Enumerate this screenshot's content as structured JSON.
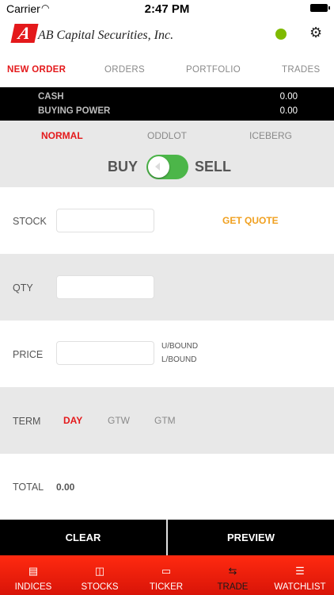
{
  "status_bar": {
    "carrier": "Carrier",
    "time": "2:47 PM"
  },
  "header": {
    "logo_letter": "A",
    "company": "AB Capital Securities, Inc.",
    "connection_color": "#7fba00"
  },
  "nav": [
    {
      "label": "NEW ORDER",
      "active": true
    },
    {
      "label": "ORDERS",
      "active": false
    },
    {
      "label": "PORTFOLIO",
      "active": false
    },
    {
      "label": "TRADES",
      "active": false
    }
  ],
  "balances": {
    "cash_label": "CASH",
    "cash_value": "0.00",
    "buying_power_label": "BUYING POWER",
    "buying_power_value": "0.00"
  },
  "order_types": [
    {
      "label": "NORMAL",
      "active": true
    },
    {
      "label": "ODDLOT",
      "active": false
    },
    {
      "label": "ICEBERG",
      "active": false
    }
  ],
  "side": {
    "buy_label": "BUY",
    "sell_label": "SELL",
    "toggle_color": "#4cb649"
  },
  "form": {
    "stock_label": "STOCK",
    "stock_value": "",
    "get_quote": "GET QUOTE",
    "qty_label": "QTY",
    "qty_value": "",
    "price_label": "PRICE",
    "price_value": "",
    "upper_bound": "U/BOUND",
    "lower_bound": "L/BOUND",
    "term_label": "TERM",
    "terms": [
      {
        "label": "DAY",
        "active": true
      },
      {
        "label": "GTW",
        "active": false
      },
      {
        "label": "GTM",
        "active": false
      }
    ],
    "total_label": "TOTAL",
    "total_value": "0.00"
  },
  "actions": {
    "clear": "CLEAR",
    "preview": "PREVIEW"
  },
  "tabbar": [
    {
      "label": "INDICES",
      "icon": "indices-icon",
      "active": false
    },
    {
      "label": "STOCKS",
      "icon": "stocks-icon",
      "active": false
    },
    {
      "label": "TICKER",
      "icon": "ticker-icon",
      "active": false
    },
    {
      "label": "TRADE",
      "icon": "trade-icon",
      "active": true
    },
    {
      "label": "WATCHLIST",
      "icon": "watchlist-icon",
      "active": false
    }
  ],
  "colors": {
    "accent": "#e4191b",
    "quote": "#f0a020",
    "tabbar": "#e8180a"
  }
}
